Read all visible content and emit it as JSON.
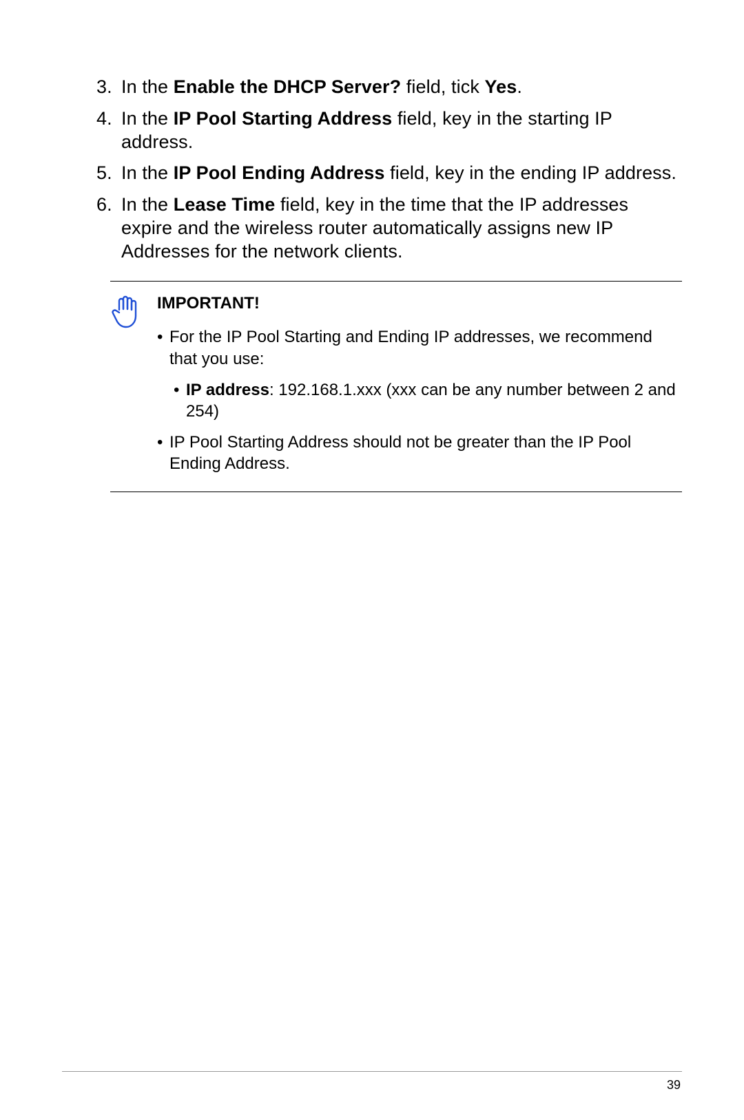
{
  "steps": [
    {
      "num": "3.",
      "segments": [
        {
          "t": "In the "
        },
        {
          "t": "Enable the DHCP Server?",
          "b": true
        },
        {
          "t": " field, tick "
        },
        {
          "t": "Yes",
          "b": true
        },
        {
          "t": "."
        }
      ]
    },
    {
      "num": "4.",
      "segments": [
        {
          "t": "In the "
        },
        {
          "t": "IP Pool Starting Address",
          "b": true
        },
        {
          "t": " field, key in the starting IP address."
        }
      ]
    },
    {
      "num": "5.",
      "segments": [
        {
          "t": "In the "
        },
        {
          "t": "IP Pool Ending Address",
          "b": true
        },
        {
          "t": " field, key in the ending IP address."
        }
      ]
    },
    {
      "num": "6.",
      "segments": [
        {
          "t": "In the "
        },
        {
          "t": "Lease Time",
          "b": true
        },
        {
          "t": " field, key in the time that the IP addresses expire and the wireless router automatically assigns new IP Addresses for the network clients."
        }
      ]
    }
  ],
  "note": {
    "title_bold": "IMPORTANT",
    "title_tail": "!",
    "bullets": [
      {
        "segments": [
          {
            "t": "For the IP Pool Starting and Ending IP addresses, we recommend that you use:"
          }
        ],
        "sub": [
          {
            "segments": [
              {
                "t": "IP address",
                "b": true
              },
              {
                "t": ": 192.168.1.xxx (xxx can be any number between 2 and 254)"
              }
            ]
          }
        ]
      },
      {
        "segments": [
          {
            "t": "IP Pool Starting Address should not be greater than the IP Pool Ending Address."
          }
        ]
      }
    ]
  },
  "page_number": "39",
  "bullet_char": "•"
}
